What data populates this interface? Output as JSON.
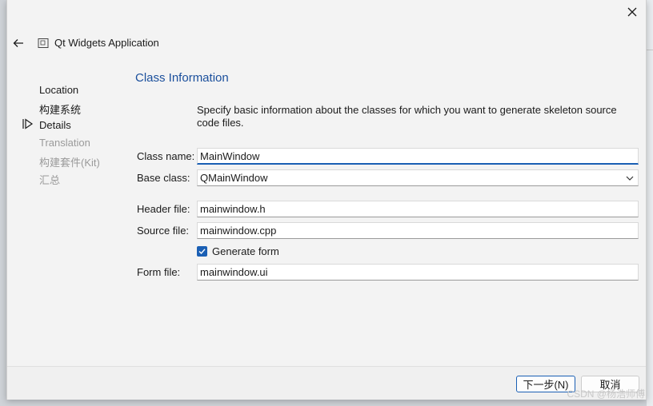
{
  "window": {
    "title": "Qt Widgets Application",
    "close_icon": "close-icon",
    "back_icon": "back-arrow-icon",
    "app_icon": "wizard-app-icon"
  },
  "steps": [
    {
      "label": "Location",
      "state": "done"
    },
    {
      "label": "构建系统",
      "state": "done"
    },
    {
      "label": "Details",
      "state": "current"
    },
    {
      "label": "Translation",
      "state": "pending"
    },
    {
      "label": "构建套件(Kit)",
      "state": "pending"
    },
    {
      "label": "汇总",
      "state": "pending"
    }
  ],
  "page": {
    "title": "Class Information",
    "description": "Specify basic information about the classes for which you want to generate skeleton source code files."
  },
  "form": {
    "class_name_label": "Class name:",
    "class_name_value": "MainWindow",
    "base_class_label": "Base class:",
    "base_class_value": "QMainWindow",
    "header_file_label": "Header file:",
    "header_file_value": "mainwindow.h",
    "source_file_label": "Source file:",
    "source_file_value": "mainwindow.cpp",
    "generate_form_label": "Generate form",
    "generate_form_checked": true,
    "form_file_label": "Form file:",
    "form_file_value": "mainwindow.ui"
  },
  "footer": {
    "next_label": "下一步(N)",
    "cancel_label": "取消"
  },
  "watermark": "CSDN @杨浩师傅",
  "colors": {
    "accent": "#1a5fb4",
    "title_blue": "#1a4f9c",
    "disabled_text": "#9a9a9a"
  }
}
